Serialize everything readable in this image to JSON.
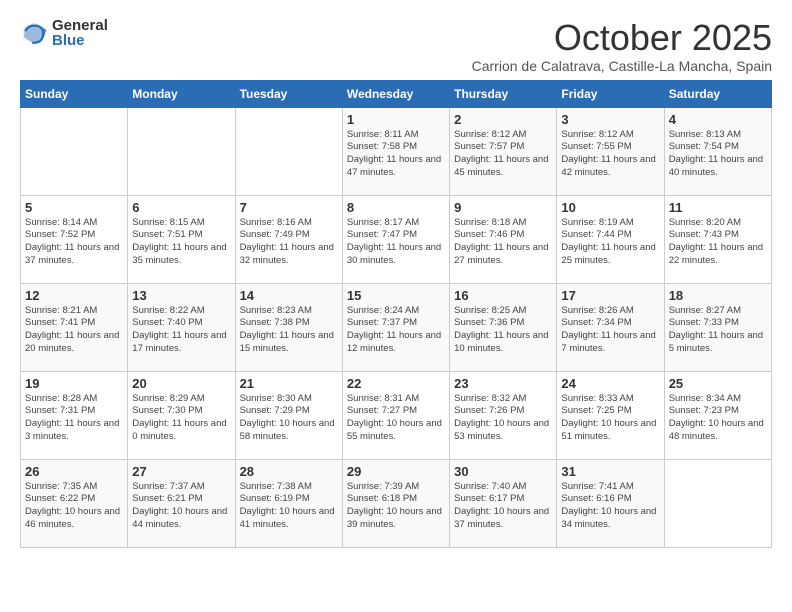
{
  "logo": {
    "general": "General",
    "blue": "Blue"
  },
  "header": {
    "month": "October 2025",
    "location": "Carrion de Calatrava, Castille-La Mancha, Spain"
  },
  "days_of_week": [
    "Sunday",
    "Monday",
    "Tuesday",
    "Wednesday",
    "Thursday",
    "Friday",
    "Saturday"
  ],
  "weeks": [
    [
      {
        "day": "",
        "info": ""
      },
      {
        "day": "",
        "info": ""
      },
      {
        "day": "",
        "info": ""
      },
      {
        "day": "1",
        "info": "Sunrise: 8:11 AM\nSunset: 7:58 PM\nDaylight: 11 hours and 47 minutes."
      },
      {
        "day": "2",
        "info": "Sunrise: 8:12 AM\nSunset: 7:57 PM\nDaylight: 11 hours and 45 minutes."
      },
      {
        "day": "3",
        "info": "Sunrise: 8:12 AM\nSunset: 7:55 PM\nDaylight: 11 hours and 42 minutes."
      },
      {
        "day": "4",
        "info": "Sunrise: 8:13 AM\nSunset: 7:54 PM\nDaylight: 11 hours and 40 minutes."
      }
    ],
    [
      {
        "day": "5",
        "info": "Sunrise: 8:14 AM\nSunset: 7:52 PM\nDaylight: 11 hours and 37 minutes."
      },
      {
        "day": "6",
        "info": "Sunrise: 8:15 AM\nSunset: 7:51 PM\nDaylight: 11 hours and 35 minutes."
      },
      {
        "day": "7",
        "info": "Sunrise: 8:16 AM\nSunset: 7:49 PM\nDaylight: 11 hours and 32 minutes."
      },
      {
        "day": "8",
        "info": "Sunrise: 8:17 AM\nSunset: 7:47 PM\nDaylight: 11 hours and 30 minutes."
      },
      {
        "day": "9",
        "info": "Sunrise: 8:18 AM\nSunset: 7:46 PM\nDaylight: 11 hours and 27 minutes."
      },
      {
        "day": "10",
        "info": "Sunrise: 8:19 AM\nSunset: 7:44 PM\nDaylight: 11 hours and 25 minutes."
      },
      {
        "day": "11",
        "info": "Sunrise: 8:20 AM\nSunset: 7:43 PM\nDaylight: 11 hours and 22 minutes."
      }
    ],
    [
      {
        "day": "12",
        "info": "Sunrise: 8:21 AM\nSunset: 7:41 PM\nDaylight: 11 hours and 20 minutes."
      },
      {
        "day": "13",
        "info": "Sunrise: 8:22 AM\nSunset: 7:40 PM\nDaylight: 11 hours and 17 minutes."
      },
      {
        "day": "14",
        "info": "Sunrise: 8:23 AM\nSunset: 7:38 PM\nDaylight: 11 hours and 15 minutes."
      },
      {
        "day": "15",
        "info": "Sunrise: 8:24 AM\nSunset: 7:37 PM\nDaylight: 11 hours and 12 minutes."
      },
      {
        "day": "16",
        "info": "Sunrise: 8:25 AM\nSunset: 7:36 PM\nDaylight: 11 hours and 10 minutes."
      },
      {
        "day": "17",
        "info": "Sunrise: 8:26 AM\nSunset: 7:34 PM\nDaylight: 11 hours and 7 minutes."
      },
      {
        "day": "18",
        "info": "Sunrise: 8:27 AM\nSunset: 7:33 PM\nDaylight: 11 hours and 5 minutes."
      }
    ],
    [
      {
        "day": "19",
        "info": "Sunrise: 8:28 AM\nSunset: 7:31 PM\nDaylight: 11 hours and 3 minutes."
      },
      {
        "day": "20",
        "info": "Sunrise: 8:29 AM\nSunset: 7:30 PM\nDaylight: 11 hours and 0 minutes."
      },
      {
        "day": "21",
        "info": "Sunrise: 8:30 AM\nSunset: 7:29 PM\nDaylight: 10 hours and 58 minutes."
      },
      {
        "day": "22",
        "info": "Sunrise: 8:31 AM\nSunset: 7:27 PM\nDaylight: 10 hours and 55 minutes."
      },
      {
        "day": "23",
        "info": "Sunrise: 8:32 AM\nSunset: 7:26 PM\nDaylight: 10 hours and 53 minutes."
      },
      {
        "day": "24",
        "info": "Sunrise: 8:33 AM\nSunset: 7:25 PM\nDaylight: 10 hours and 51 minutes."
      },
      {
        "day": "25",
        "info": "Sunrise: 8:34 AM\nSunset: 7:23 PM\nDaylight: 10 hours and 48 minutes."
      }
    ],
    [
      {
        "day": "26",
        "info": "Sunrise: 7:35 AM\nSunset: 6:22 PM\nDaylight: 10 hours and 46 minutes."
      },
      {
        "day": "27",
        "info": "Sunrise: 7:37 AM\nSunset: 6:21 PM\nDaylight: 10 hours and 44 minutes."
      },
      {
        "day": "28",
        "info": "Sunrise: 7:38 AM\nSunset: 6:19 PM\nDaylight: 10 hours and 41 minutes."
      },
      {
        "day": "29",
        "info": "Sunrise: 7:39 AM\nSunset: 6:18 PM\nDaylight: 10 hours and 39 minutes."
      },
      {
        "day": "30",
        "info": "Sunrise: 7:40 AM\nSunset: 6:17 PM\nDaylight: 10 hours and 37 minutes."
      },
      {
        "day": "31",
        "info": "Sunrise: 7:41 AM\nSunset: 6:16 PM\nDaylight: 10 hours and 34 minutes."
      },
      {
        "day": "",
        "info": ""
      }
    ]
  ]
}
